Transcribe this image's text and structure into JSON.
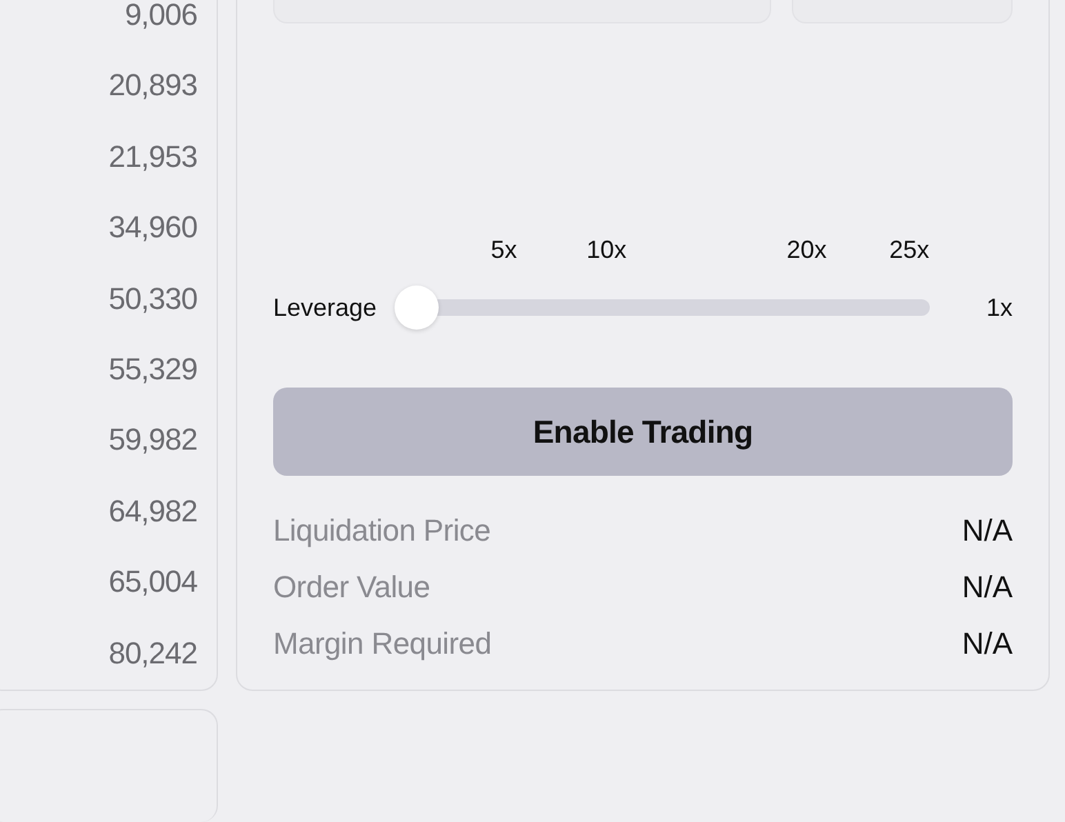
{
  "order_book": {
    "values": [
      "9,006",
      "20,893",
      "21,953",
      "34,960",
      "50,330",
      "55,329",
      "59,982",
      "64,982",
      "65,004",
      "80,242"
    ]
  },
  "order_form": {
    "leverage": {
      "label": "Leverage",
      "level": 0,
      "reading": "1x",
      "ticks": [
        "5x",
        "10x",
        "20x",
        "25x"
      ]
    },
    "button": {
      "label": "Enable Trading",
      "disabled": true
    },
    "summary": [
      {
        "label": "Liquidation Price",
        "value": "N/A"
      },
      {
        "label": "Order Value",
        "value": "N/A"
      },
      {
        "label": "Margin Required",
        "value": "N/A"
      }
    ]
  }
}
